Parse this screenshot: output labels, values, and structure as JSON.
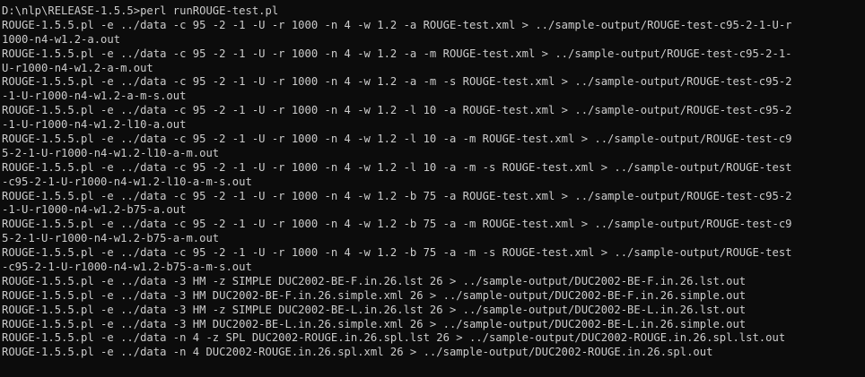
{
  "console": {
    "lines": [
      "D:\\nlp\\RELEASE-1.5.5>perl runROUGE-test.pl",
      "ROUGE-1.5.5.pl -e ../data -c 95 -2 -1 -U -r 1000 -n 4 -w 1.2 -a ROUGE-test.xml > ../sample-output/ROUGE-test-c95-2-1-U-r",
      "1000-n4-w1.2-a.out",
      "ROUGE-1.5.5.pl -e ../data -c 95 -2 -1 -U -r 1000 -n 4 -w 1.2 -a -m ROUGE-test.xml > ../sample-output/ROUGE-test-c95-2-1-",
      "U-r1000-n4-w1.2-a-m.out",
      "ROUGE-1.5.5.pl -e ../data -c 95 -2 -1 -U -r 1000 -n 4 -w 1.2 -a -m -s ROUGE-test.xml > ../sample-output/ROUGE-test-c95-2",
      "-1-U-r1000-n4-w1.2-a-m-s.out",
      "ROUGE-1.5.5.pl -e ../data -c 95 -2 -1 -U -r 1000 -n 4 -w 1.2 -l 10 -a ROUGE-test.xml > ../sample-output/ROUGE-test-c95-2",
      "-1-U-r1000-n4-w1.2-l10-a.out",
      "ROUGE-1.5.5.pl -e ../data -c 95 -2 -1 -U -r 1000 -n 4 -w 1.2 -l 10 -a -m ROUGE-test.xml > ../sample-output/ROUGE-test-c9",
      "5-2-1-U-r1000-n4-w1.2-l10-a-m.out",
      "ROUGE-1.5.5.pl -e ../data -c 95 -2 -1 -U -r 1000 -n 4 -w 1.2 -l 10 -a -m -s ROUGE-test.xml > ../sample-output/ROUGE-test",
      "-c95-2-1-U-r1000-n4-w1.2-l10-a-m-s.out",
      "ROUGE-1.5.5.pl -e ../data -c 95 -2 -1 -U -r 1000 -n 4 -w 1.2 -b 75 -a ROUGE-test.xml > ../sample-output/ROUGE-test-c95-2",
      "-1-U-r1000-n4-w1.2-b75-a.out",
      "ROUGE-1.5.5.pl -e ../data -c 95 -2 -1 -U -r 1000 -n 4 -w 1.2 -b 75 -a -m ROUGE-test.xml > ../sample-output/ROUGE-test-c9",
      "5-2-1-U-r1000-n4-w1.2-b75-a-m.out",
      "ROUGE-1.5.5.pl -e ../data -c 95 -2 -1 -U -r 1000 -n 4 -w 1.2 -b 75 -a -m -s ROUGE-test.xml > ../sample-output/ROUGE-test",
      "-c95-2-1-U-r1000-n4-w1.2-b75-a-m-s.out",
      "ROUGE-1.5.5.pl -e ../data -3 HM -z SIMPLE DUC2002-BE-F.in.26.lst 26 > ../sample-output/DUC2002-BE-F.in.26.lst.out",
      "ROUGE-1.5.5.pl -e ../data -3 HM DUC2002-BE-F.in.26.simple.xml 26 > ../sample-output/DUC2002-BE-F.in.26.simple.out",
      "ROUGE-1.5.5.pl -e ../data -3 HM -z SIMPLE DUC2002-BE-L.in.26.lst 26 > ../sample-output/DUC2002-BE-L.in.26.lst.out",
      "ROUGE-1.5.5.pl -e ../data -3 HM DUC2002-BE-L.in.26.simple.xml 26 > ../sample-output/DUC2002-BE-L.in.26.simple.out",
      "ROUGE-1.5.5.pl -e ../data -n 4 -z SPL DUC2002-ROUGE.in.26.spl.lst 26 > ../sample-output/DUC2002-ROUGE.in.26.spl.lst.out",
      "ROUGE-1.5.5.pl -e ../data -n 4 DUC2002-ROUGE.in.26.spl.xml 26 > ../sample-output/DUC2002-ROUGE.in.26.spl.out"
    ]
  }
}
